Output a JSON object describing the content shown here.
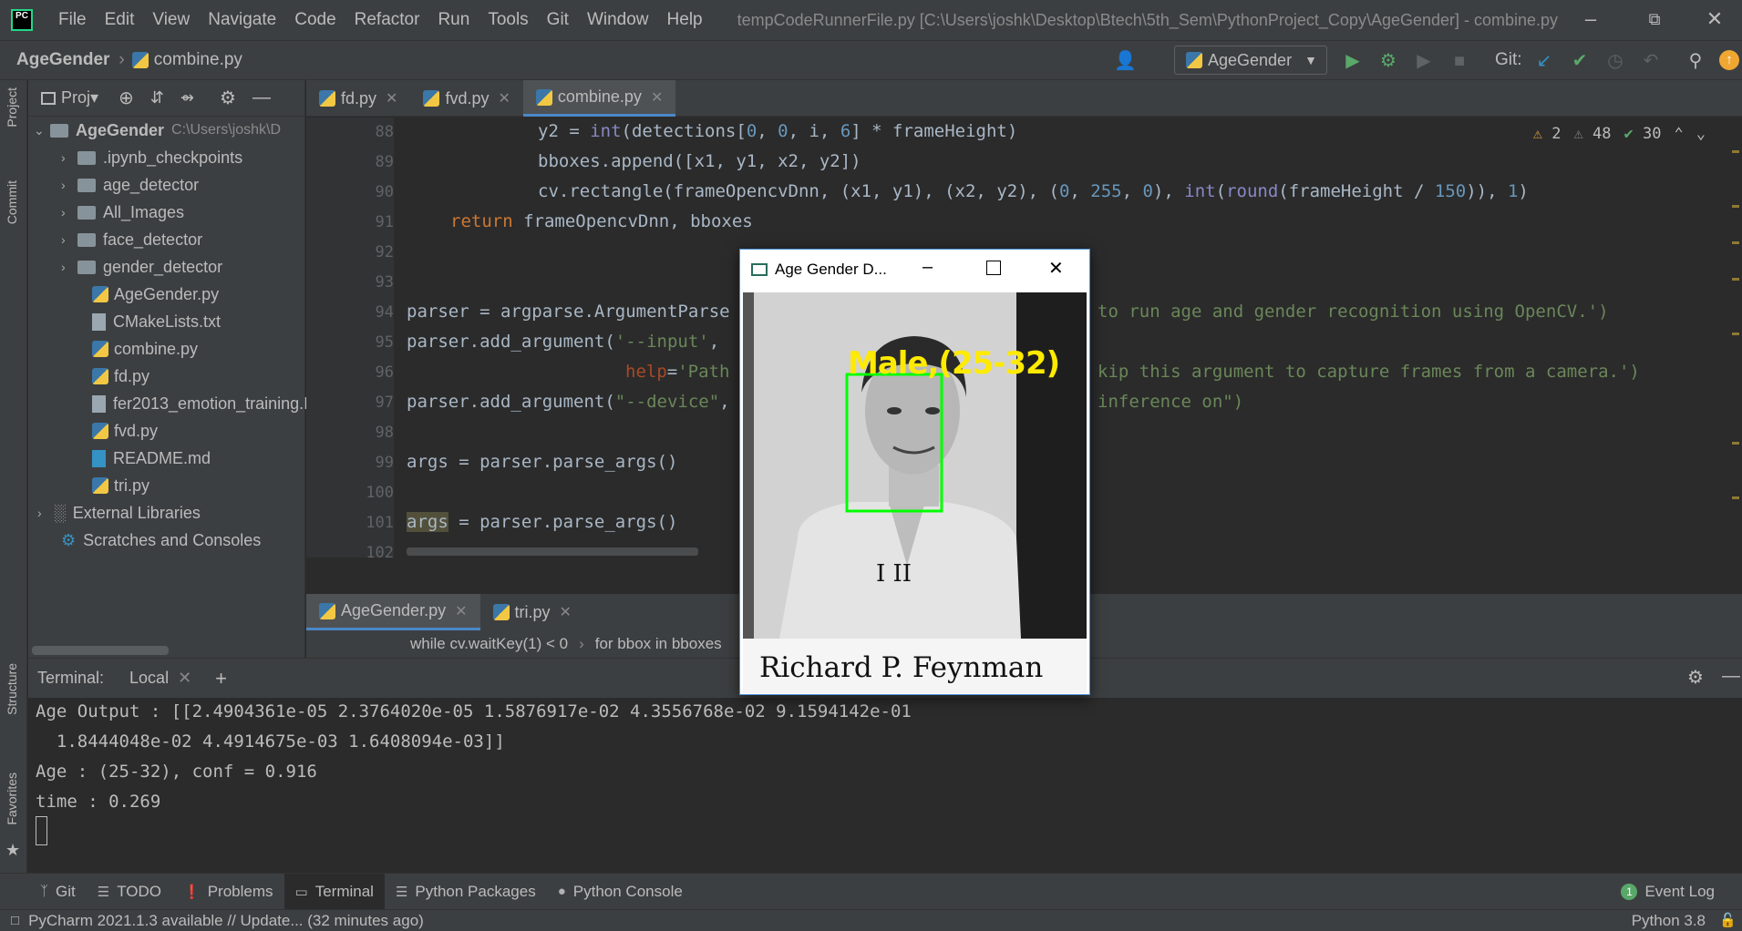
{
  "menubar": {
    "items": [
      "File",
      "Edit",
      "View",
      "Navigate",
      "Code",
      "Refactor",
      "Run",
      "Tools",
      "Git",
      "Window",
      "Help"
    ],
    "window_title": "tempCodeRunnerFile.py [C:\\Users\\joshk\\Desktop\\Btech\\5th_Sem\\PythonProject_Copy\\AgeGender] - combine.py"
  },
  "navbar": {
    "project": "AgeGender",
    "file": "combine.py",
    "run_config": "AgeGender",
    "git_label": "Git:"
  },
  "left_strip": {
    "project": "Project",
    "commit": "Commit",
    "structure": "Structure",
    "favorites": "Favorites"
  },
  "project_panel": {
    "header": "Proj▾",
    "root_name": "AgeGender",
    "root_path": "C:\\Users\\joshk\\D",
    "items": [
      {
        "name": ".ipynb_checkpoints",
        "kind": "folder"
      },
      {
        "name": "age_detector",
        "kind": "folder"
      },
      {
        "name": "All_Images",
        "kind": "folder"
      },
      {
        "name": "face_detector",
        "kind": "folder"
      },
      {
        "name": "gender_detector",
        "kind": "folder"
      },
      {
        "name": "AgeGender.py",
        "kind": "py"
      },
      {
        "name": "CMakeLists.txt",
        "kind": "txt"
      },
      {
        "name": "combine.py",
        "kind": "py"
      },
      {
        "name": "fd.py",
        "kind": "py"
      },
      {
        "name": "fer2013_emotion_training.I",
        "kind": "file"
      },
      {
        "name": "fvd.py",
        "kind": "py"
      },
      {
        "name": "README.md",
        "kind": "md"
      },
      {
        "name": "tri.py",
        "kind": "py"
      }
    ],
    "external": "External Libraries",
    "scratches": "Scratches and Consoles"
  },
  "editor_tabs": [
    "fd.py",
    "fvd.py",
    "combine.py"
  ],
  "inspections": {
    "warnings": "2",
    "weak": "48",
    "ok": "30"
  },
  "code": {
    "line_numbers": [
      "88",
      "89",
      "90",
      "91",
      "92",
      "93",
      "94",
      "95",
      "96",
      "97",
      "98",
      "99",
      "100",
      "101",
      "102"
    ],
    "l88_a": "y2 = ",
    "l88_b": "int",
    "l88_c": "(detections[",
    "l88_d": "0",
    "l88_e": ", ",
    "l88_f": "0",
    "l88_g": ", i, ",
    "l88_h": "6",
    "l88_i": "] * frameHeight)",
    "l89": "bboxes.append([x1, y1, x2, y2])",
    "l90_a": "cv.rectangle(frameOpencvDnn, (x1, y1), (x2, y2), (",
    "l90_b": "0",
    "l90_c": ", ",
    "l90_d": "255",
    "l90_e": ", ",
    "l90_f": "0",
    "l90_g": "), ",
    "l90_h": "int",
    "l90_i": "(",
    "l90_j": "round",
    "l90_k": "(frameHeight / ",
    "l90_l": "150",
    "l90_m": ")), ",
    "l90_n": "1",
    "l90_o": ")",
    "l91_a": "return",
    "l91_b": " frameOpencvDnn, bboxes",
    "l94_a": "parser = argparse.ArgumentParse",
    "l94_b": "to run age and gender recognition using OpenCV.')",
    "l95_a": "parser.add_argument(",
    "l95_b": "'--input'",
    "l95_c": ",",
    "l96_a": "help",
    "l96_b": "=",
    "l96_c": "'Path",
    "l96_d": "kip this argument to capture frames from a camera.')",
    "l97_a": "parser.add_argument(",
    "l97_b": "\"--device\"",
    "l97_c": ",",
    "l97_d": "inference on\")",
    "l99": "args = parser.parse_args()",
    "l101_a": "args",
    "l101_b": " = parser.parse_args()"
  },
  "editor2_tabs": [
    "AgeGender.py",
    "tri.py"
  ],
  "editor_breadcrumb": {
    "first": "while cv.waitKey(1) < 0",
    "sep": "›",
    "second": "for bbox in bboxes"
  },
  "cv_window": {
    "title": "Age Gender D...",
    "label": "Male,(25-32)",
    "caption": "Richard P. Feynman",
    "board": "I  II"
  },
  "terminal": {
    "title": "Terminal:",
    "tab": "Local",
    "lines": [
      "Age Output : [[2.4904361e-05 2.3764020e-05 1.5876917e-02 4.3556768e-02 9.1594142e-01",
      "  1.8444048e-02 4.4914675e-03 1.6408094e-03]]",
      "Age : (25-32), conf = 0.916",
      "time : 0.269"
    ]
  },
  "bottom_tools": [
    "Git",
    "TODO",
    "Problems",
    "Terminal",
    "Python Packages",
    "Python Console"
  ],
  "event_log": "Event Log",
  "event_count": "1",
  "status": {
    "message": "PyCharm 2021.1.3 available // Update... (32 minutes ago)",
    "interpreter": "Python 3.8"
  }
}
